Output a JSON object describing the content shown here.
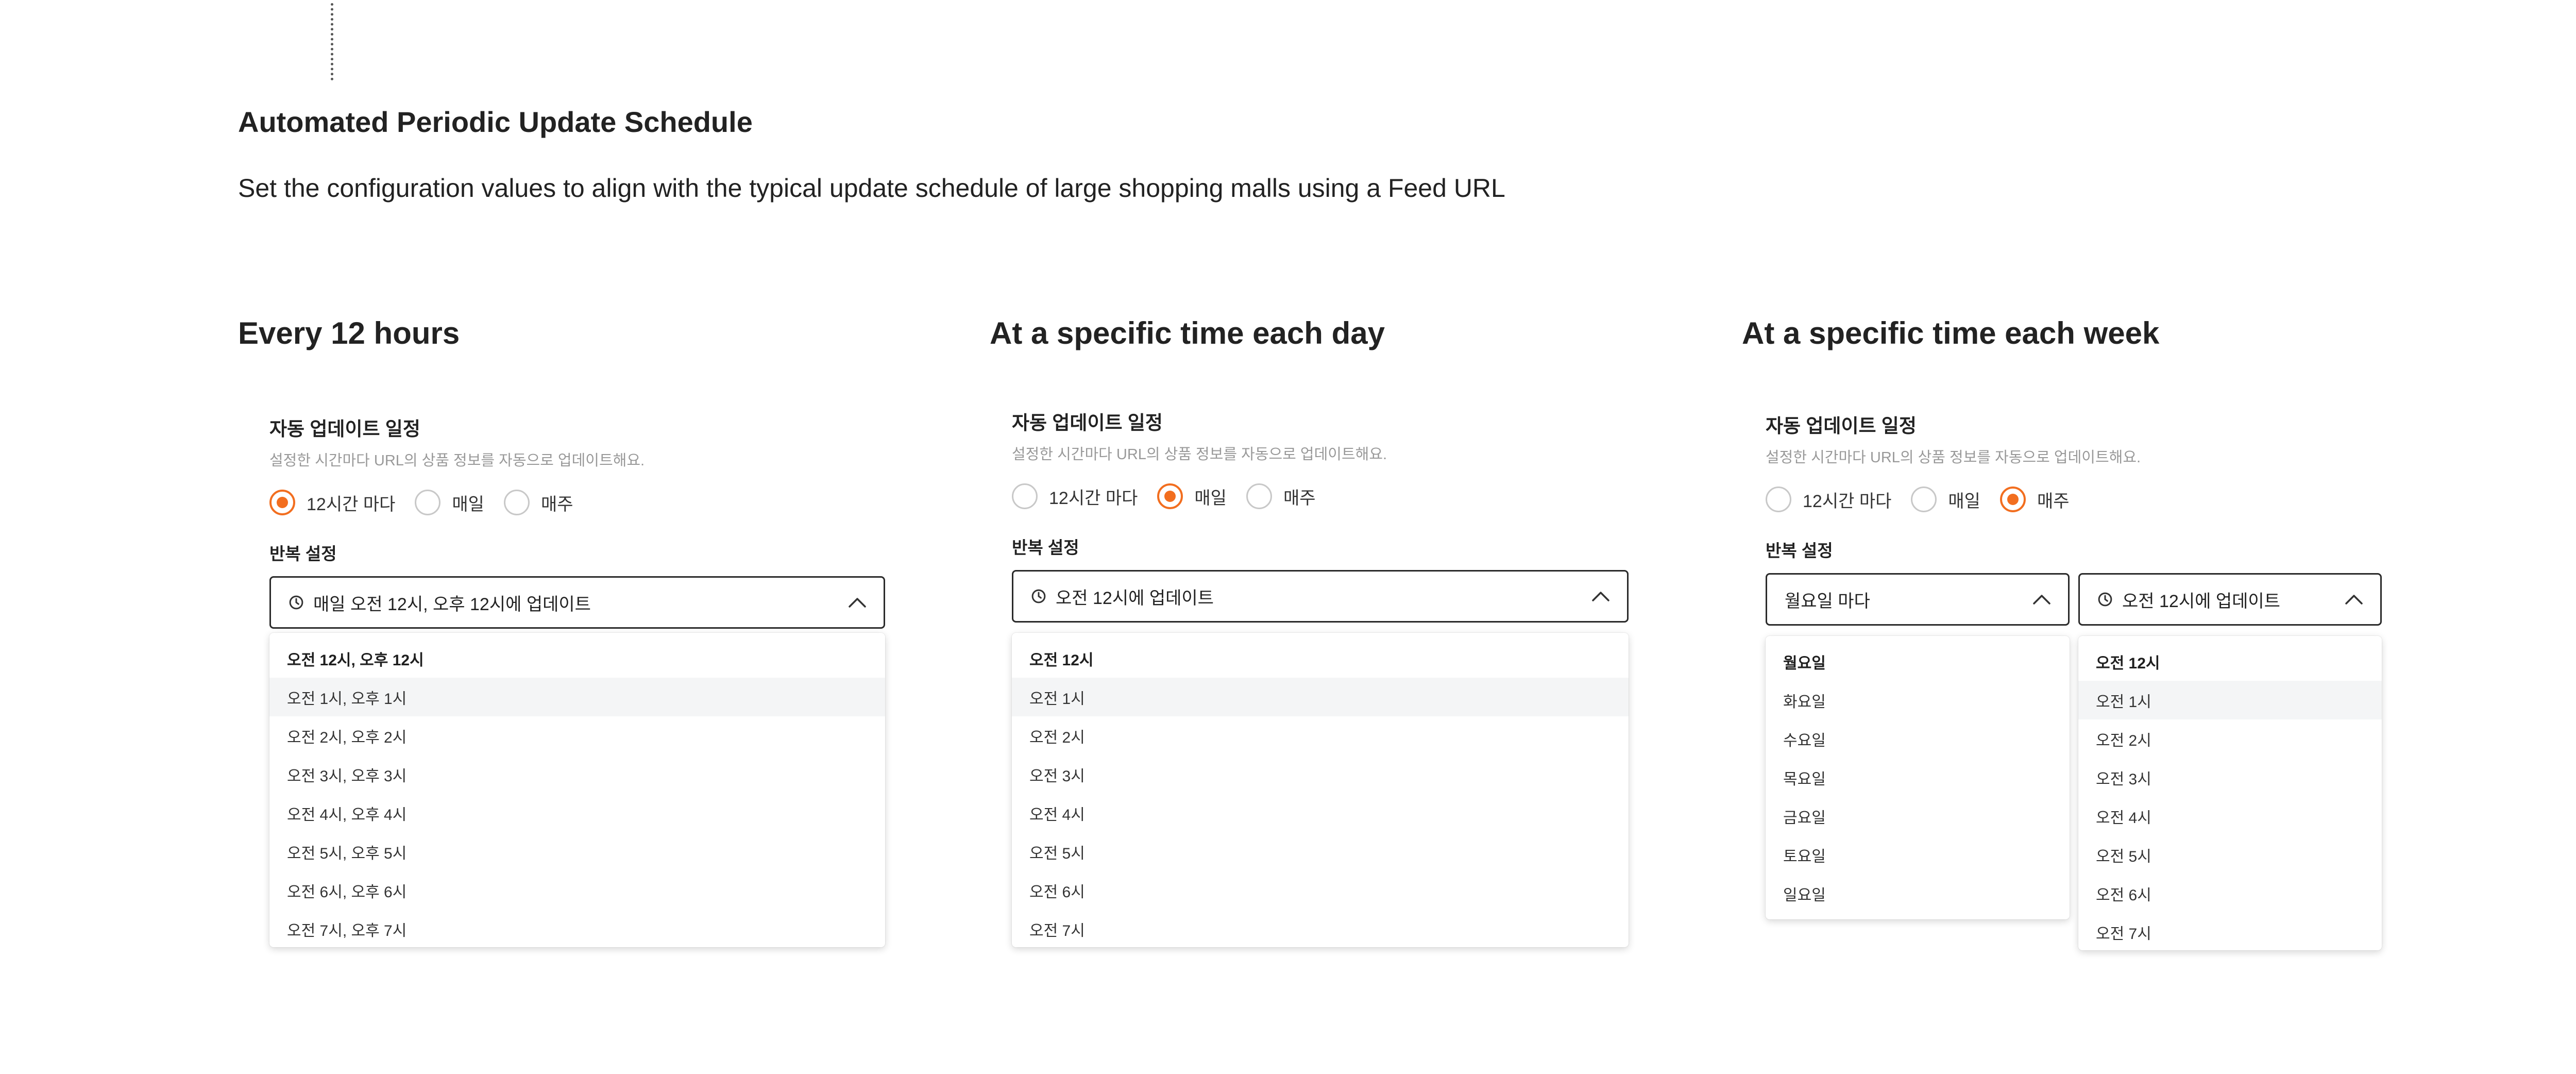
{
  "page": {
    "title": "Automated Periodic Update Schedule",
    "description": "Set the configuration values to align with the typical update schedule of large shopping malls using a Feed URL"
  },
  "colors": {
    "accent": "#f26e1f",
    "border": "#2a2a2a",
    "hover": "#f4f5f6"
  },
  "columns": [
    {
      "heading": "Every 12 hours",
      "form_title": "자동 업데이트 일정",
      "form_desc": "설정한 시간마다 URL의 상품 정보를 자동으로 업데이트해요.",
      "radios": [
        {
          "label": "12시간 마다",
          "checked": true
        },
        {
          "label": "매일",
          "checked": false
        },
        {
          "label": "매주",
          "checked": false
        }
      ],
      "repeat_label": "반복 설정",
      "select_value": "매일 오전 12시, 오후 12시에 업데이트",
      "select_icon": "clock-icon",
      "options": [
        "오전 12시, 오후 12시",
        "오전 1시, 오후 1시",
        "오전 2시, 오후 2시",
        "오전 3시, 오후 3시",
        "오전 4시, 오후 4시",
        "오전 5시, 오후 5시",
        "오전 6시, 오후 6시",
        "오전 7시, 오후 7시"
      ]
    },
    {
      "heading": "At a specific time each day",
      "form_title": "자동 업데이트 일정",
      "form_desc": "설정한 시간마다 URL의 상품 정보를 자동으로 업데이트해요.",
      "radios": [
        {
          "label": "12시간 마다",
          "checked": false
        },
        {
          "label": "매일",
          "checked": true
        },
        {
          "label": "매주",
          "checked": false
        }
      ],
      "repeat_label": "반복 설정",
      "select_value": "오전 12시에 업데이트",
      "select_icon": "clock-icon",
      "options": [
        "오전 12시",
        "오전 1시",
        "오전 2시",
        "오전 3시",
        "오전 4시",
        "오전 5시",
        "오전 6시",
        "오전 7시"
      ]
    },
    {
      "heading": "At a specific time each week",
      "form_title": "자동 업데이트 일정",
      "form_desc": "설정한 시간마다 URL의 상품 정보를 자동으로 업데이트해요.",
      "radios": [
        {
          "label": "12시간 마다",
          "checked": false
        },
        {
          "label": "매일",
          "checked": false
        },
        {
          "label": "매주",
          "checked": true
        }
      ],
      "repeat_label": "반복 설정",
      "day_select_value": "월요일 마다",
      "day_options": [
        "월요일",
        "화요일",
        "수요일",
        "목요일",
        "금요일",
        "토요일",
        "일요일"
      ],
      "select_value": "오전 12시에 업데이트",
      "select_icon": "clock-icon",
      "options": [
        "오전 12시",
        "오전 1시",
        "오전 2시",
        "오전 3시",
        "오전 4시",
        "오전 5시",
        "오전 6시",
        "오전 7시"
      ]
    }
  ]
}
